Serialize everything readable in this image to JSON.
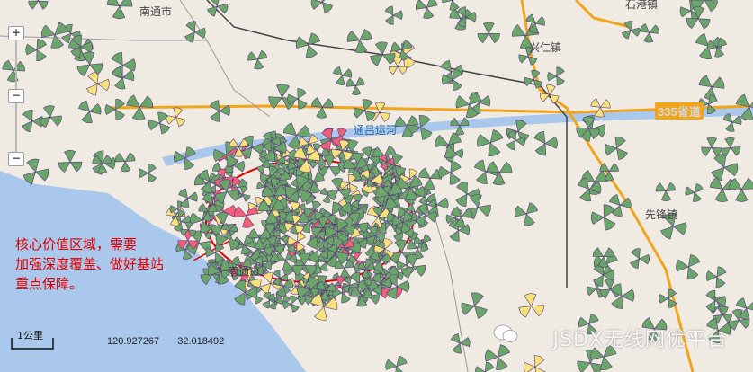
{
  "map": {
    "places": {
      "nantong_top": "南通市",
      "xingren": "兴仁镇",
      "tongyang": "通吕运河",
      "xianfeng": "先锋镇",
      "nantong_center": "南通市",
      "top_right": "石港镇"
    },
    "highway_label": "335省道",
    "annotation": {
      "line1": "核心价值区域，需要",
      "line2": "加强深度覆盖、做好基站",
      "line3": "重点保障。"
    },
    "coordinates": {
      "lon": "120.927267",
      "lat": "32.018492"
    },
    "scale_label": "1公里",
    "watermark": "JSDX无线网优平台",
    "colors": {
      "water": "#a9c8ec",
      "land": "#efeae2",
      "site_green": "#6aa56a",
      "site_outline": "#5a3a7a",
      "site_yellow": "#f6e27a",
      "site_red": "#f0607a",
      "highway": "#f0a51c",
      "annotation": "#e00000"
    }
  },
  "controls": {
    "zoom_in": "+",
    "zoom_mid": "−",
    "zoom_out": "−"
  }
}
